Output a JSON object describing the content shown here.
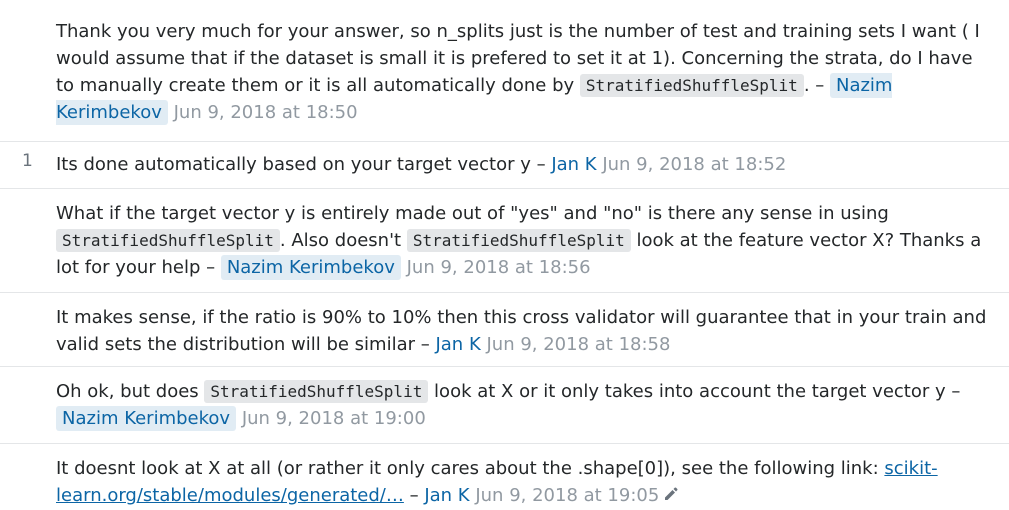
{
  "comments": [
    {
      "score": "",
      "text_1": "Thank you very much for your answer, so n_splits just is the number of test and training sets I want ( I would assume that if the dataset is small it is prefered to set it at 1). Concerning the strata, do I have to manually create them or it is all automatically done by ",
      "code_1": "StratifiedShuffleSplit",
      "text_2": ". – ",
      "user": "Nazim Kerimbekov",
      "date": "Jun 9, 2018 at 18:50"
    },
    {
      "score": "1",
      "text_1": "Its done automatically based on your target vector y – ",
      "user": "Jan K",
      "date": "Jun 9, 2018 at 18:52"
    },
    {
      "score": "",
      "text_1": "What if the target vector y is entirely made out of \"yes\" and \"no\" is there any sense in using ",
      "code_1": "StratifiedShuffleSplit",
      "text_2": ". Also doesn't ",
      "code_2": "StratifiedShuffleSplit",
      "text_3": " look at the feature vector X? Thanks a lot for your help – ",
      "user": "Nazim Kerimbekov",
      "date": "Jun 9, 2018 at 18:56"
    },
    {
      "score": "",
      "text_1": "It makes sense, if the ratio is 90% to 10% then this cross validator will guarantee that in your train and valid sets the distribution will be similar – ",
      "user": "Jan K",
      "date": "Jun 9, 2018 at 18:58"
    },
    {
      "score": "",
      "text_1": "Oh ok, but does ",
      "code_1": "StratifiedShuffleSplit",
      "text_2": " look at X or it only takes into account the target vector y – ",
      "user": "Nazim Kerimbekov",
      "date": "Jun 9, 2018 at 19:00"
    },
    {
      "score": "",
      "text_1": "It doesnt look at X at all (or rather it only cares about the .shape[0]), see the following link: ",
      "link": "scikit-learn.org/stable/modules/generated/…",
      "text_2": " – ",
      "user": "Jan K",
      "date": "Jun 9, 2018 at 19:05",
      "edit_icon": "pencil-icon"
    }
  ]
}
